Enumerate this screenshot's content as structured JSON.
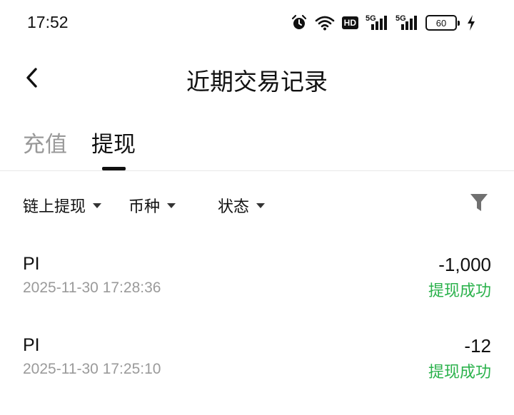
{
  "status_bar": {
    "time": "17:52",
    "hd_label": "HD",
    "signal1_label": "5G",
    "signal2_label": "5G",
    "battery_level": "60",
    "icons": [
      "alarm-icon",
      "wifi-icon",
      "hd-icon",
      "signal-icon",
      "signal-icon",
      "battery-icon",
      "charging-icon"
    ]
  },
  "header": {
    "title": "近期交易记录",
    "back_icon": "chevron-left-icon"
  },
  "tabs": [
    {
      "label": "充值",
      "active": false
    },
    {
      "label": "提现",
      "active": true
    }
  ],
  "filters": [
    {
      "label": "链上提现"
    },
    {
      "label": "币种"
    },
    {
      "label": "状态"
    }
  ],
  "filter_icon": "funnel-icon",
  "records": [
    {
      "coin": "PI",
      "time": "2025-11-30 17:28:36",
      "amount": "-1,000",
      "status": "提现成功"
    },
    {
      "coin": "PI",
      "time": "2025-11-30 17:25:10",
      "amount": "-12",
      "status": "提现成功"
    }
  ],
  "colors": {
    "success": "#2bb24c",
    "inactive_tab": "#999999",
    "secondary_text": "#9a9a9a"
  }
}
